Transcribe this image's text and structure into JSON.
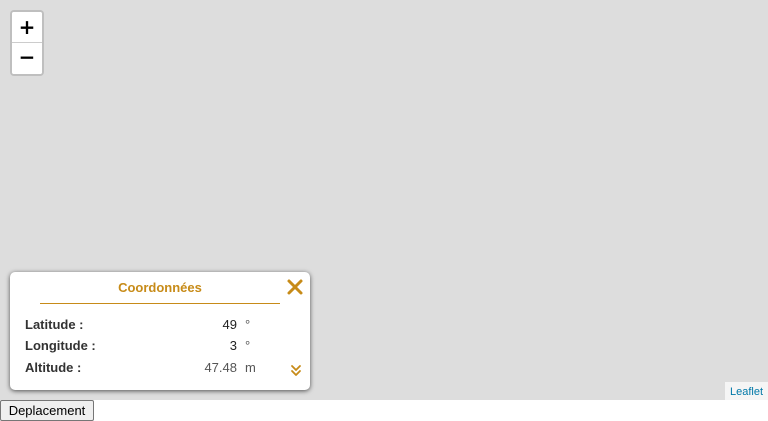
{
  "map": {
    "zoom_in_label": "+",
    "zoom_out_label": "−",
    "attribution": "Leaflet",
    "background_color": "#dddddd"
  },
  "coordinates_panel": {
    "title": "Coordonnées",
    "accent_color": "#c78b18",
    "close_icon": "close-icon",
    "expand_icon": "double-chevron-down-icon",
    "rows": [
      {
        "label": "Latitude :",
        "value": "49",
        "unit": "°"
      },
      {
        "label": "Longitude :",
        "value": "3",
        "unit": "°"
      },
      {
        "label": "Altitude :",
        "value": "47.48",
        "unit": "m"
      }
    ]
  },
  "controls": {
    "deplacement_label": "Deplacement"
  }
}
